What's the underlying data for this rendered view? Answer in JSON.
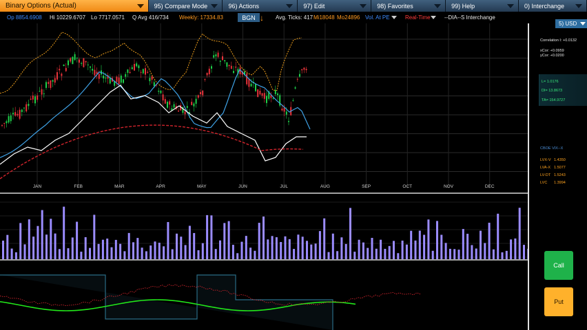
{
  "menu": {
    "items": [
      {
        "label": "Binary Options (Actual)",
        "name": "menu-binary-options",
        "active": true
      },
      {
        "label": "95) Compare Mode",
        "name": "menu-compare-mode",
        "active": false
      },
      {
        "label": "96) Actions",
        "name": "menu-actions",
        "active": false
      },
      {
        "label": "97) Edit",
        "name": "menu-edit",
        "active": false
      },
      {
        "label": "98) Favorites",
        "name": "menu-favorites",
        "active": false
      },
      {
        "label": "99) Help",
        "name": "menu-help",
        "active": false
      },
      {
        "label": "0) Interchange",
        "name": "menu-interchange",
        "active": false
      }
    ]
  },
  "status": {
    "open": "Op 8854.6908",
    "high": "Hi 10229.6707",
    "low": "Lo 7717.0571",
    "q_avg": "Q Avg 416/734",
    "weekly": "Weekly: 17334.83",
    "bgn": "BGN",
    "avg_ticks": "Avg. Ticks: 417",
    "mi": "Mi18048",
    "mo": "Mo24896",
    "vol": "Vol. At PE",
    "realtime": "Real-Time",
    "interchange": "--DIA--S Interchange"
  },
  "right_panel": {
    "currency": "5) USD",
    "correlation": "Correlation I: +0.0132",
    "xcor": "xCor: +0.0959",
    "ycor": "yCor: +0.0200",
    "l_value": "L= 1.0176",
    "di_value": "DI= 13.8673",
    "ta_value": "TA= 154.9727",
    "cboe_title": "CBOE VIX--X",
    "lv_rows": [
      {
        "label": "LVX-V",
        "value": "1.4350"
      },
      {
        "label": "LVA-X",
        "value": "1.5077"
      },
      {
        "label": "LV-DT",
        "value": "1.5243"
      },
      {
        "label": "LVC",
        "value": "1.3994"
      }
    ],
    "call_label": "Call",
    "put_label": "Put"
  },
  "colors": {
    "up_candle": "#1fd14a",
    "down_candle": "#e8333a",
    "orange_line": "#f0a01c",
    "blue_line": "#3fa2e6",
    "white_line": "#ffffff",
    "red_curve": "#d0242c",
    "volume_bar": "#9b8cff",
    "osc_green": "#22e81a"
  },
  "chart_data": {
    "type": "line",
    "x_axis_labels": [
      "JAN",
      "FEB",
      "MAR",
      "APR",
      "MAY",
      "JUN",
      "JUL",
      "AUG",
      "SEP",
      "OCT",
      "NOV",
      "DEC"
    ],
    "grid": true
  }
}
